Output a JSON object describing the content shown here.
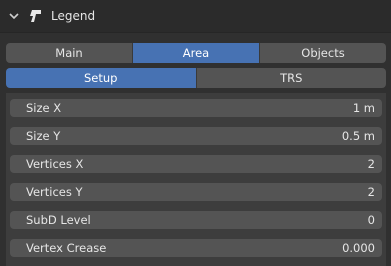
{
  "panel": {
    "title": "Legend"
  },
  "tabs_main": [
    "Main",
    "Area",
    "Objects"
  ],
  "tabs_sub": [
    "Setup",
    "TRS"
  ],
  "fields": [
    {
      "label": "Size X",
      "value": "1 m"
    },
    {
      "label": "Size Y",
      "value": "0.5 m"
    },
    {
      "label": "Vertices X",
      "value": "2"
    },
    {
      "label": "Vertices Y",
      "value": "2"
    },
    {
      "label": "SubD Level",
      "value": "0"
    },
    {
      "label": "Vertex Crease",
      "value": "0.000"
    }
  ]
}
